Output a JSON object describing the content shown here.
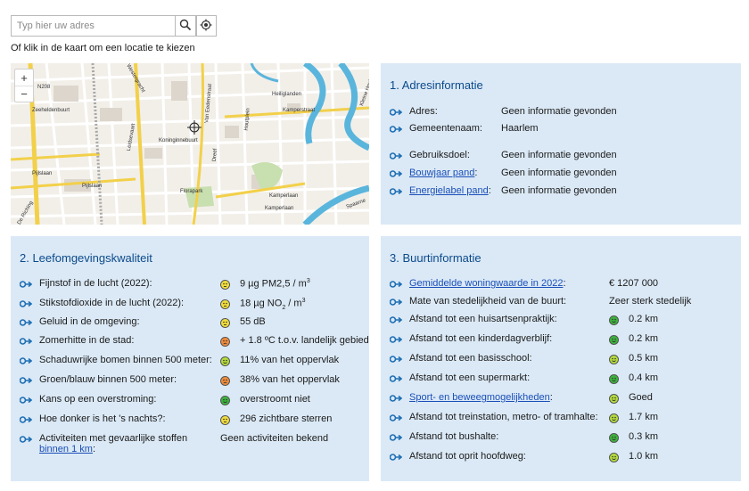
{
  "search": {
    "placeholder": "Typ hier uw adres",
    "hint": "Of klik in de kaart om een locatie te kiezen"
  },
  "map": {
    "zoom_in": "+",
    "zoom_out": "−",
    "labels": [
      "N208",
      "Westergracht",
      "Zeeheldenbuurt",
      "Leidsevaart",
      "Pijlslaan",
      "Pijlslaan",
      "Koninginnebuurt",
      "Florapark",
      "Van Eedenstraat",
      "Dreef",
      "Houtplein",
      "Kamperlaan",
      "Kamperlaan",
      "Heiliglanden",
      "Kamperstraat",
      "Spaarne",
      "Kleine Houtweg",
      "De Riching"
    ]
  },
  "adres": {
    "title": "1. Adresinformatie",
    "rows": [
      {
        "label": "Adres:",
        "value": "Geen informatie gevonden",
        "link": false
      },
      {
        "label": "Gemeentenaam:",
        "value": "Haarlem",
        "link": false
      },
      {
        "label": "Gebruiksdoel:",
        "value": "Geen informatie gevonden",
        "link": false
      },
      {
        "label": "Bouwjaar pand",
        "suffix": ":",
        "value": "Geen informatie gevonden",
        "link": true
      },
      {
        "label": "Energielabel pand",
        "suffix": ":",
        "value": "Geen informatie gevonden",
        "link": true
      }
    ]
  },
  "leef": {
    "title": "2. Leefomgevingskwaliteit",
    "rows": [
      {
        "label": "Fijnstof in de lucht (2022)",
        "suffix": ":",
        "value_pre": "9 µg PM2,5 / m",
        "sup": "3",
        "smile": "neutral"
      },
      {
        "label": "Stikstofdioxide in de lucht (2022)",
        "suffix": ":",
        "value_pre": "18 µg NO",
        "sub": "2",
        "value_mid": " / m",
        "sup": "3",
        "smile": "neutral"
      },
      {
        "label": "Geluid in de omgeving",
        "suffix": ":",
        "value": "55 dB",
        "smile": "neutral"
      },
      {
        "label": "Zomerhitte in de stad",
        "suffix": ":",
        "value": "+ 1.8 ºC t.o.v. landelijk gebied",
        "smile": "bad"
      },
      {
        "label": "Schaduwrijke bomen binnen 500 meter",
        "suffix": ":",
        "value": "11% van het oppervlak",
        "smile": "fair"
      },
      {
        "label": "Groen/blauw binnen 500 meter",
        "suffix": ":",
        "value": "38% van het oppervlak",
        "smile": "bad"
      },
      {
        "label": "Kans op een overstroming",
        "suffix": ":",
        "value": "overstroomt niet",
        "smile": "good"
      },
      {
        "label": "Hoe donker is het 's nachts?",
        "suffix": ":",
        "value": "296 zichtbare sterren",
        "smile": "neutral"
      },
      {
        "label": "Activiteiten met gevaarlijke stoffen",
        "label2": "binnen 1 km",
        "suffix": ":",
        "value": "Geen activiteiten bekend",
        "smile": "none"
      }
    ]
  },
  "buurt": {
    "title": "3. Buurtinformatie",
    "rows": [
      {
        "label": "Gemiddelde woningwaarde in 2022",
        "suffix": ":",
        "link": true,
        "value": "€ 1207 000",
        "smile": "none"
      },
      {
        "label": "Mate van stedelijkheid van de buurt:",
        "link": false,
        "value": "Zeer sterk stedelijk",
        "smile": "none"
      },
      {
        "label": "Afstand tot een huisartsenpraktijk:",
        "link": false,
        "value": "0.2 km",
        "smile": "good"
      },
      {
        "label": "Afstand tot een kinderdagverblijf:",
        "link": false,
        "value": "0.2 km",
        "smile": "good"
      },
      {
        "label": "Afstand tot een basisschool:",
        "link": false,
        "value": "0.5 km",
        "smile": "fair"
      },
      {
        "label": "Afstand tot een supermarkt:",
        "link": false,
        "value": "0.4 km",
        "smile": "good"
      },
      {
        "label": "Sport- en beweegmogelijkheden",
        "suffix": ":",
        "link": true,
        "value": "Goed",
        "smile": "fair"
      },
      {
        "label": "Afstand tot treinstation, metro- of tramhalte:",
        "link": false,
        "value": "1.7 km",
        "smile": "fair"
      },
      {
        "label": "Afstand tot bushalte:",
        "link": false,
        "value": "0.3 km",
        "smile": "good"
      },
      {
        "label": "Afstand tot oprit hoofdweg:",
        "link": false,
        "value": "1.0 km",
        "smile": "fair"
      }
    ]
  },
  "colors": {
    "panel_bg": "#dbe9f6",
    "title": "#0b4a8c",
    "link": "#1a4fb8",
    "arrow": "#1e6fb4",
    "smile_good": "#3cb43c",
    "smile_fair": "#b4dc3c",
    "smile_neutral": "#f0dc3c",
    "smile_bad": "#f08c3c"
  }
}
